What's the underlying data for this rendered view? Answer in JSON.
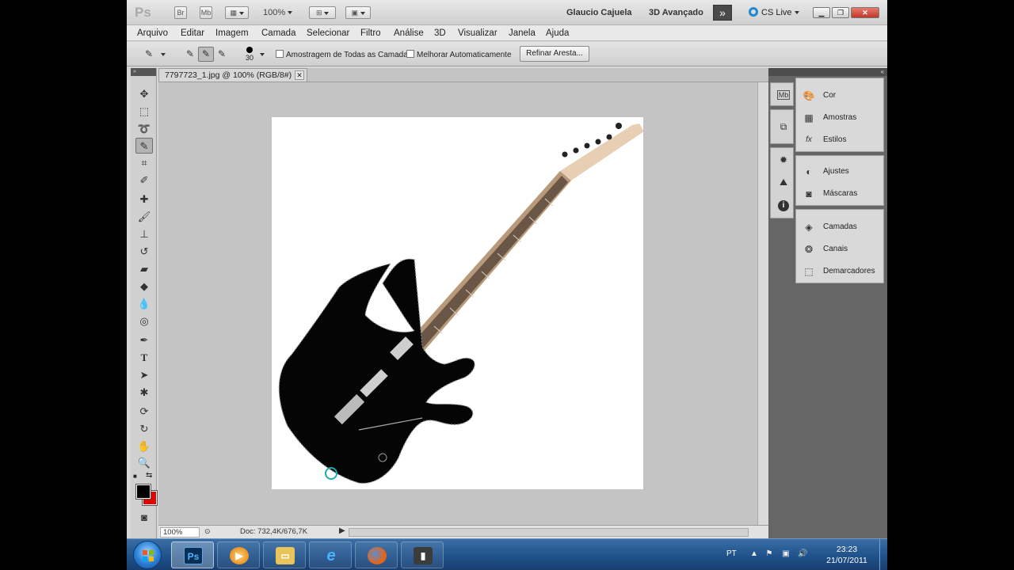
{
  "app": {
    "logo": "Ps",
    "bridge_label": "Br",
    "minibridge_label": "Mb",
    "zoom": "100%",
    "workspace_user": "Glaucio Cajuela",
    "workspace_preset": "3D Avançado",
    "cslive": "CS Live"
  },
  "menu": [
    "Arquivo",
    "Editar",
    "Imagem",
    "Camada",
    "Selecionar",
    "Filtro",
    "Análise",
    "3D",
    "Visualizar",
    "Janela",
    "Ajuda"
  ],
  "options": {
    "brush_size": "30",
    "sample_all_layers": "Amostragem de Todas as Camadas",
    "auto_enhance": "Melhorar Automaticamente",
    "refine_edge": "Refinar Aresta..."
  },
  "document": {
    "tab_title": "7797723_1.jpg @ 100% (RGB/8#)",
    "status_zoom": "100%",
    "doc_size": "Doc: 732,4K/676,7K"
  },
  "panels": {
    "group1": [
      {
        "label": "Cor",
        "icon": "color-icon"
      },
      {
        "label": "Amostras",
        "icon": "swatches-icon"
      },
      {
        "label": "Estilos",
        "icon": "styles-icon"
      }
    ],
    "group2": [
      {
        "label": "Ajustes",
        "icon": "adjustments-icon"
      },
      {
        "label": "Máscaras",
        "icon": "masks-icon"
      }
    ],
    "group3": [
      {
        "label": "Camadas",
        "icon": "layers-icon"
      },
      {
        "label": "Canais",
        "icon": "channels-icon"
      },
      {
        "label": "Demarcadores",
        "icon": "paths-icon"
      }
    ]
  },
  "colors": {
    "foreground": "#000000",
    "background": "#e60000"
  },
  "taskbar": {
    "language": "PT",
    "time": "23:23",
    "date": "21/07/2011"
  }
}
